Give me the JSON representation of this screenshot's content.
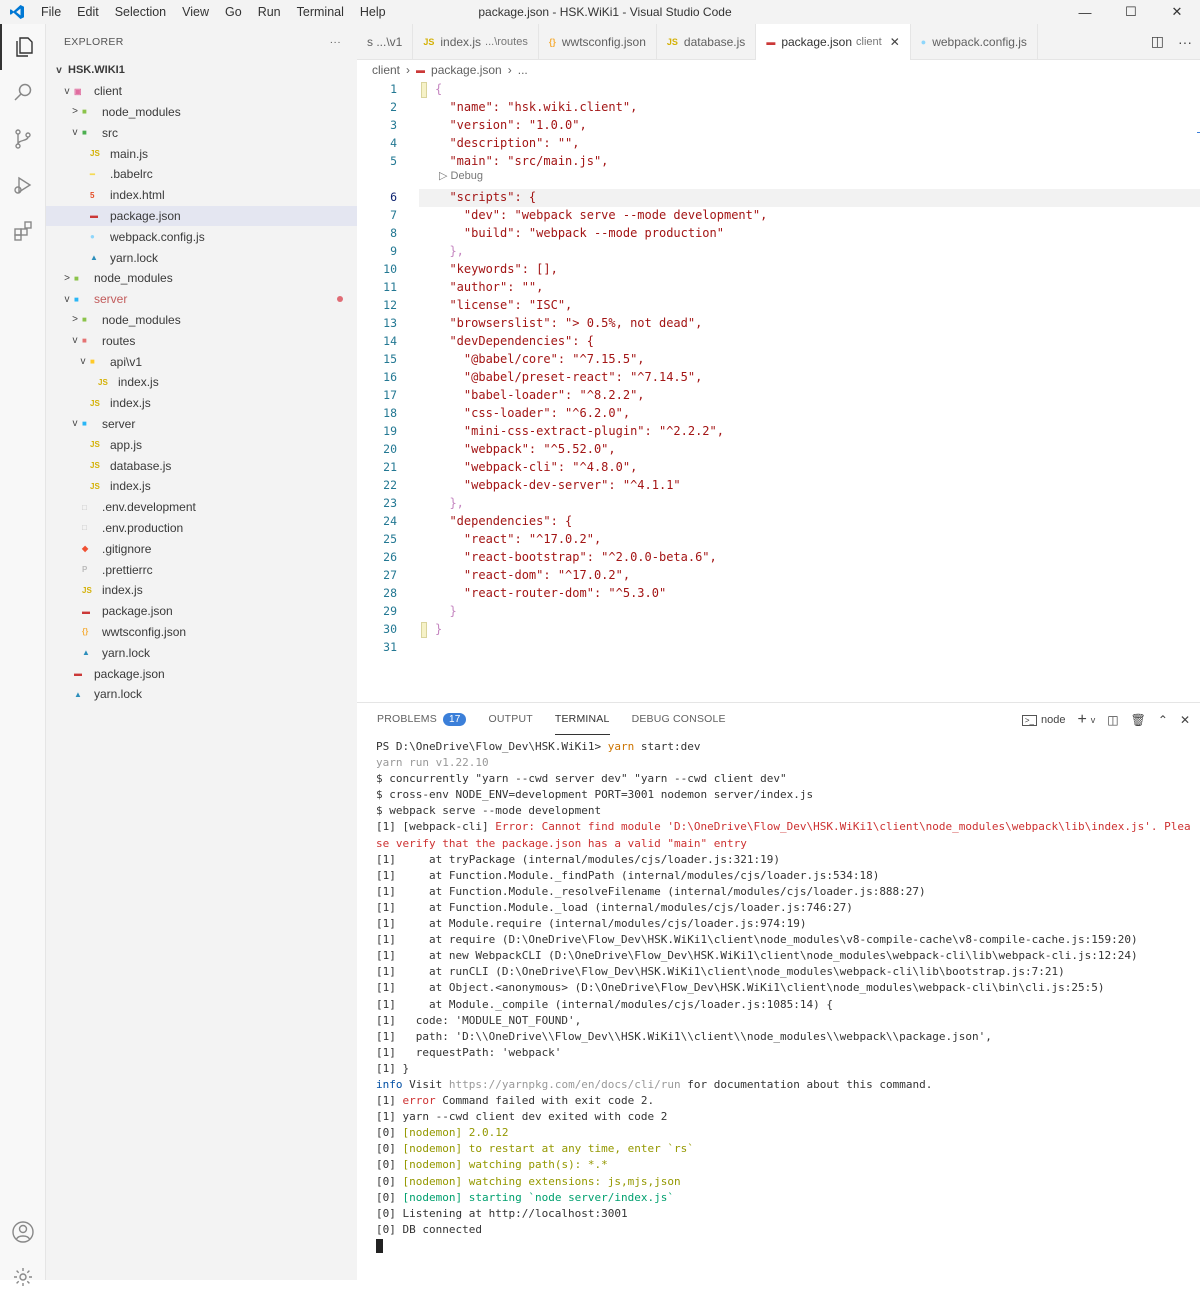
{
  "window": {
    "title": "package.json - HSK.WiKi1 - Visual Studio Code",
    "menu": [
      "File",
      "Edit",
      "Selection",
      "View",
      "Go",
      "Run",
      "Terminal",
      "Help"
    ]
  },
  "explorer": {
    "header": "EXPLORER",
    "more": "···",
    "root": "HSK.WIKI1",
    "items": [
      {
        "label": "client",
        "depth": 1,
        "tw": "v",
        "icon": "folder-client-icon",
        "glyph": "▣",
        "color": "#e06c9f"
      },
      {
        "label": "node_modules",
        "depth": 2,
        "tw": ">",
        "icon": "folder-node-icon",
        "glyph": "■",
        "color": "#8bc34a"
      },
      {
        "label": "src",
        "depth": 2,
        "tw": "v",
        "icon": "folder-src-icon",
        "glyph": "■",
        "color": "#4caf50"
      },
      {
        "label": "main.js",
        "depth": 3,
        "tw": "",
        "icon": "js-file-icon",
        "glyph": "JS",
        "color": "#d4b106"
      },
      {
        "label": ".babelrc",
        "depth": 3,
        "tw": "",
        "icon": "babel-file-icon",
        "glyph": "━",
        "color": "#f5da55"
      },
      {
        "label": "index.html",
        "depth": 3,
        "tw": "",
        "icon": "html-file-icon",
        "glyph": "5",
        "color": "#e44d26"
      },
      {
        "label": "package.json",
        "depth": 3,
        "tw": "",
        "icon": "npm-file-icon",
        "glyph": "▬",
        "color": "#cb3837",
        "selected": true
      },
      {
        "label": "webpack.config.js",
        "depth": 3,
        "tw": "",
        "icon": "webpack-file-icon",
        "glyph": "●",
        "color": "#8ed6fb"
      },
      {
        "label": "yarn.lock",
        "depth": 3,
        "tw": "",
        "icon": "yarn-file-icon",
        "glyph": "▲",
        "color": "#2c8ebb"
      },
      {
        "label": "node_modules",
        "depth": 1,
        "tw": ">",
        "icon": "folder-node-icon",
        "glyph": "■",
        "color": "#8bc34a"
      },
      {
        "label": "server",
        "depth": 1,
        "tw": "v",
        "icon": "folder-server-icon",
        "glyph": "■",
        "color": "#29b6f6",
        "modified": true
      },
      {
        "label": "node_modules",
        "depth": 2,
        "tw": ">",
        "icon": "folder-node-icon",
        "glyph": "■",
        "color": "#8bc34a"
      },
      {
        "label": "routes",
        "depth": 2,
        "tw": "v",
        "icon": "folder-routes-icon",
        "glyph": "■",
        "color": "#e57373"
      },
      {
        "label": "api\\v1",
        "depth": 3,
        "tw": "v",
        "icon": "folder-api-icon",
        "glyph": "■",
        "color": "#ffca28"
      },
      {
        "label": "index.js",
        "depth": 4,
        "tw": "",
        "icon": "js-file-icon",
        "glyph": "JS",
        "color": "#d4b106"
      },
      {
        "label": "index.js",
        "depth": 3,
        "tw": "",
        "icon": "js-file-icon",
        "glyph": "JS",
        "color": "#d4b106"
      },
      {
        "label": "server",
        "depth": 2,
        "tw": "v",
        "icon": "folder-server-icon",
        "glyph": "■",
        "color": "#29b6f6"
      },
      {
        "label": "app.js",
        "depth": 3,
        "tw": "",
        "icon": "js-file-icon",
        "glyph": "JS",
        "color": "#d4b106"
      },
      {
        "label": "database.js",
        "depth": 3,
        "tw": "",
        "icon": "js-file-icon",
        "glyph": "JS",
        "color": "#d4b106"
      },
      {
        "label": "index.js",
        "depth": 3,
        "tw": "",
        "icon": "js-file-icon",
        "glyph": "JS",
        "color": "#d4b106"
      },
      {
        "label": ".env.development",
        "depth": 2,
        "tw": "",
        "icon": "file-icon",
        "glyph": "□",
        "color": "#bbbbbb"
      },
      {
        "label": ".env.production",
        "depth": 2,
        "tw": "",
        "icon": "file-icon",
        "glyph": "□",
        "color": "#bbbbbb"
      },
      {
        "label": ".gitignore",
        "depth": 2,
        "tw": "",
        "icon": "git-file-icon",
        "glyph": "◆",
        "color": "#f05133"
      },
      {
        "label": ".prettierrc",
        "depth": 2,
        "tw": "",
        "icon": "prettier-file-icon",
        "glyph": "P",
        "color": "#bbbbbb"
      },
      {
        "label": "index.js",
        "depth": 2,
        "tw": "",
        "icon": "js-file-icon",
        "glyph": "JS",
        "color": "#d4b106"
      },
      {
        "label": "package.json",
        "depth": 2,
        "tw": "",
        "icon": "npm-file-icon",
        "glyph": "▬",
        "color": "#cb3837"
      },
      {
        "label": "wwtsconfig.json",
        "depth": 2,
        "tw": "",
        "icon": "json-file-icon",
        "glyph": "{}",
        "color": "#f5b041"
      },
      {
        "label": "yarn.lock",
        "depth": 2,
        "tw": "",
        "icon": "yarn-file-icon",
        "glyph": "▲",
        "color": "#2c8ebb"
      },
      {
        "label": "package.json",
        "depth": 1,
        "tw": "",
        "icon": "npm-file-icon",
        "glyph": "▬",
        "color": "#cb3837"
      },
      {
        "label": "yarn.lock",
        "depth": 1,
        "tw": "",
        "icon": "yarn-file-icon",
        "glyph": "▲",
        "color": "#2c8ebb"
      }
    ]
  },
  "tabs": [
    {
      "label": "s ...\\v1",
      "desc": "",
      "icon": "",
      "glyph": "",
      "color": "#616161"
    },
    {
      "label": "index.js",
      "desc": "...\\routes",
      "icon": "js-file-icon",
      "glyph": "JS",
      "color": "#d4b106"
    },
    {
      "label": "wwtsconfig.json",
      "desc": "",
      "icon": "json-file-icon",
      "glyph": "{}",
      "color": "#f5b041"
    },
    {
      "label": "database.js",
      "desc": "",
      "icon": "js-file-icon",
      "glyph": "JS",
      "color": "#d4b106"
    },
    {
      "label": "package.json",
      "desc": "client",
      "icon": "npm-file-icon",
      "glyph": "▬",
      "color": "#cb3837",
      "active": true
    },
    {
      "label": "webpack.config.js",
      "desc": "",
      "icon": "webpack-file-icon",
      "glyph": "●",
      "color": "#8ed6fb"
    }
  ],
  "breadcrumb": {
    "folder": "client",
    "file": "package.json",
    "rest": "..."
  },
  "editor": {
    "codelens": "▷ Debug",
    "current_line": 6,
    "lines": [
      "{",
      "  \"name\": \"hsk.wiki.client\",",
      "  \"version\": \"1.0.0\",",
      "  \"description\": \"\",",
      "  \"main\": \"src/main.js\",",
      "  \"scripts\": {",
      "    \"dev\": \"webpack serve --mode development\",",
      "    \"build\": \"webpack --mode production\"",
      "  },",
      "  \"keywords\": [],",
      "  \"author\": \"\",",
      "  \"license\": \"ISC\",",
      "  \"browserslist\": \"> 0.5%, not dead\",",
      "  \"devDependencies\": {",
      "    \"@babel/core\": \"^7.15.5\",",
      "    \"@babel/preset-react\": \"^7.14.5\",",
      "    \"babel-loader\": \"^8.2.2\",",
      "    \"css-loader\": \"^6.2.0\",",
      "    \"mini-css-extract-plugin\": \"^2.2.2\",",
      "    \"webpack\": \"^5.52.0\",",
      "    \"webpack-cli\": \"^4.8.0\",",
      "    \"webpack-dev-server\": \"^4.1.1\"",
      "  },",
      "  \"dependencies\": {",
      "    \"react\": \"^17.0.2\",",
      "    \"react-bootstrap\": \"^2.0.0-beta.6\",",
      "    \"react-dom\": \"^17.0.2\",",
      "    \"react-router-dom\": \"^5.3.0\"",
      "  }",
      "}",
      ""
    ]
  },
  "panel": {
    "tabs": {
      "problems": "PROBLEMS",
      "problems_count": "17",
      "output": "OUTPUT",
      "terminal": "TERMINAL",
      "debug": "DEBUG CONSOLE"
    },
    "shell": "node",
    "terminal": [
      [
        {
          "t": "PS D:\\OneDrive\\Flow_Dev\\HSK.WiKi1> "
        },
        {
          "t": "yarn",
          "c": "t-org"
        },
        {
          "t": " start:dev"
        }
      ],
      [
        {
          "t": "yarn run v1.22.10",
          "c": "t-gry"
        }
      ],
      [
        {
          "t": "$ concurrently \"yarn --cwd server dev\" \"yarn --cwd client dev\""
        }
      ],
      [
        {
          "t": "$ cross-env NODE_ENV=development PORT=3001 nodemon server/index.js"
        }
      ],
      [
        {
          "t": "$ webpack serve --mode development"
        }
      ],
      [
        {
          "t": "[1] [webpack-cli] "
        },
        {
          "t": "Error: Cannot find module 'D:\\OneDrive\\Flow_Dev\\HSK.WiKi1\\client\\node_modules\\webpack\\lib\\index.js'. Plea",
          "c": "t-red"
        }
      ],
      [
        {
          "t": "se verify that the package.json has a valid \"main\" entry",
          "c": "t-red"
        }
      ],
      [
        {
          "t": "[1]     at tryPackage (internal/modules/cjs/loader.js:321:19)"
        }
      ],
      [
        {
          "t": "[1]     at Function.Module._findPath (internal/modules/cjs/loader.js:534:18)"
        }
      ],
      [
        {
          "t": "[1]     at Function.Module._resolveFilename (internal/modules/cjs/loader.js:888:27)"
        }
      ],
      [
        {
          "t": "[1]     at Function.Module._load (internal/modules/cjs/loader.js:746:27)"
        }
      ],
      [
        {
          "t": "[1]     at Module.require (internal/modules/cjs/loader.js:974:19)"
        }
      ],
      [
        {
          "t": "[1]     at require (D:\\OneDrive\\Flow_Dev\\HSK.WiKi1\\client\\node_modules\\v8-compile-cache\\v8-compile-cache.js:159:20)"
        }
      ],
      [
        {
          "t": "[1]     at new WebpackCLI (D:\\OneDrive\\Flow_Dev\\HSK.WiKi1\\client\\node_modules\\webpack-cli\\lib\\webpack-cli.js:12:24)"
        }
      ],
      [
        {
          "t": "[1]     at runCLI (D:\\OneDrive\\Flow_Dev\\HSK.WiKi1\\client\\node_modules\\webpack-cli\\lib\\bootstrap.js:7:21)"
        }
      ],
      [
        {
          "t": "[1]     at Object.<anonymous> (D:\\OneDrive\\Flow_Dev\\HSK.WiKi1\\client\\node_modules\\webpack-cli\\bin\\cli.js:25:5)"
        }
      ],
      [
        {
          "t": "[1]     at Module._compile (internal/modules/cjs/loader.js:1085:14) {"
        }
      ],
      [
        {
          "t": "[1]   code: 'MODULE_NOT_FOUND',"
        }
      ],
      [
        {
          "t": "[1]   path: 'D:\\\\OneDrive\\\\Flow_Dev\\\\HSK.WiKi1\\\\client\\\\node_modules\\\\webpack\\\\package.json',"
        }
      ],
      [
        {
          "t": "[1]   requestPath: 'webpack'"
        }
      ],
      [
        {
          "t": "[1] }"
        }
      ],
      [
        {
          "t": "info",
          "c": "t-blu"
        },
        {
          "t": " Visit "
        },
        {
          "t": "https://yarnpkg.com/en/docs/cli/run",
          "c": "t-gry"
        },
        {
          "t": " for documentation about this command."
        }
      ],
      [
        {
          "t": "[1] "
        },
        {
          "t": "error",
          "c": "t-red"
        },
        {
          "t": " Command failed with exit code 2."
        }
      ],
      [
        {
          "t": "[1] yarn --cwd client dev exited with code 2"
        }
      ],
      [
        {
          "t": "[0] "
        },
        {
          "t": "[nodemon] 2.0.12",
          "c": "t-yel"
        }
      ],
      [
        {
          "t": "[0] "
        },
        {
          "t": "[nodemon] to restart at any time, enter `rs`",
          "c": "t-yel"
        }
      ],
      [
        {
          "t": "[0] "
        },
        {
          "t": "[nodemon] watching path(s): *.*",
          "c": "t-yel"
        }
      ],
      [
        {
          "t": "[0] "
        },
        {
          "t": "[nodemon] watching extensions: js,mjs,json",
          "c": "t-yel"
        }
      ],
      [
        {
          "t": "[0] "
        },
        {
          "t": "[nodemon] starting `node server/index.js`",
          "c": "t-grn"
        }
      ],
      [
        {
          "t": "[0] Listening at http://localhost:3001"
        }
      ],
      [
        {
          "t": "[0] DB connected"
        }
      ]
    ]
  }
}
